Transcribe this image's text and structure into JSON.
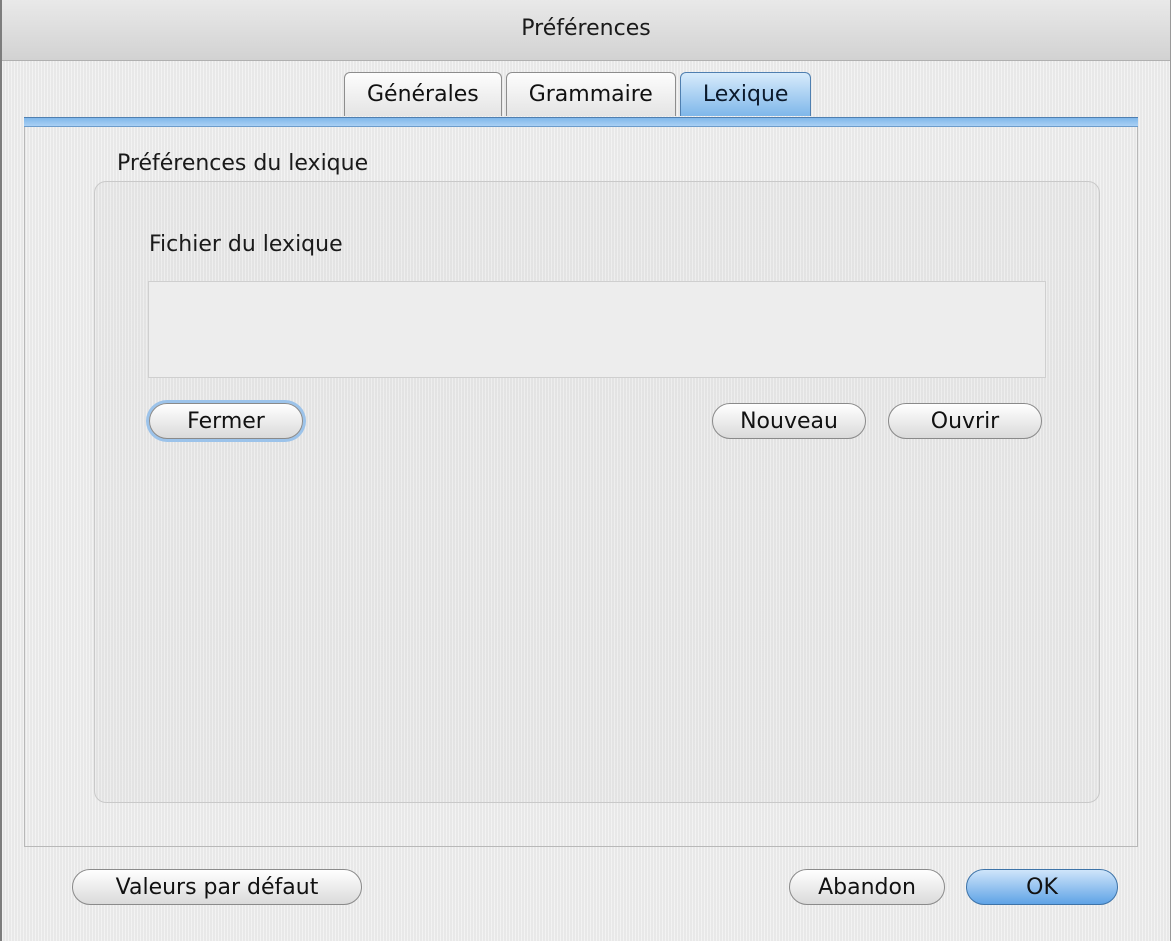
{
  "window": {
    "title": "Préférences"
  },
  "tabs": [
    {
      "label": "Générales",
      "active": false
    },
    {
      "label": "Grammaire",
      "active": false
    },
    {
      "label": "Lexique",
      "active": true
    }
  ],
  "lexique": {
    "group_title": "Préférences du lexique",
    "file_label": "Fichier du lexique",
    "file_value": "",
    "buttons": {
      "close": "Fermer",
      "new": "Nouveau",
      "open": "Ouvrir"
    }
  },
  "footer": {
    "defaults_button": "Valeurs par défaut",
    "cancel_button": "Abandon",
    "ok_button": "OK"
  },
  "colors": {
    "accent": "#7fb7ea",
    "window_bg": "#ececec"
  }
}
